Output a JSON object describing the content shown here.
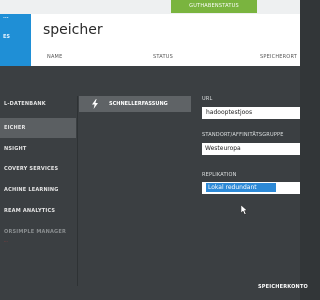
{
  "topbar": {
    "credit_label": "GUTHABENSTATUS"
  },
  "left_strip": {
    "label_top": "...",
    "label_mid": "ES"
  },
  "header": {
    "title": "speicher",
    "columns": [
      "NAME",
      "STATUS",
      "SPEICHERORT"
    ]
  },
  "nav": {
    "items": [
      {
        "label": "L-DATENBANK",
        "selected": false
      },
      {
        "label": "EICHER",
        "selected": true
      },
      {
        "label": "NSIGHT",
        "selected": false
      },
      {
        "label": "COVERY SERVICES",
        "selected": false
      },
      {
        "label": "ACHINE LEARNING",
        "selected": false
      },
      {
        "label": "REAM ANALYTICS",
        "selected": false
      },
      {
        "label": "ORSIMPLE MANAGER",
        "selected": false
      }
    ],
    "warning": "..."
  },
  "quick": {
    "label": "SCHNELLERFASSUNG",
    "icon": "bolt-icon"
  },
  "form": {
    "url_label": "URL",
    "url_value": "hadooptestjoos",
    "location_label": "STANDORT/AFFINITÄTSGRUPPE",
    "location_value": "Westeuropa",
    "replication_label": "REPLIKATION",
    "replication_value": "Lokal redundant"
  },
  "footer": {
    "label": "SPEICHERKONTO"
  },
  "colors": {
    "accent": "#1f8fd6",
    "credit": "#7ab43f",
    "panel": "#3b3f42",
    "selection": "#2d89d6"
  }
}
